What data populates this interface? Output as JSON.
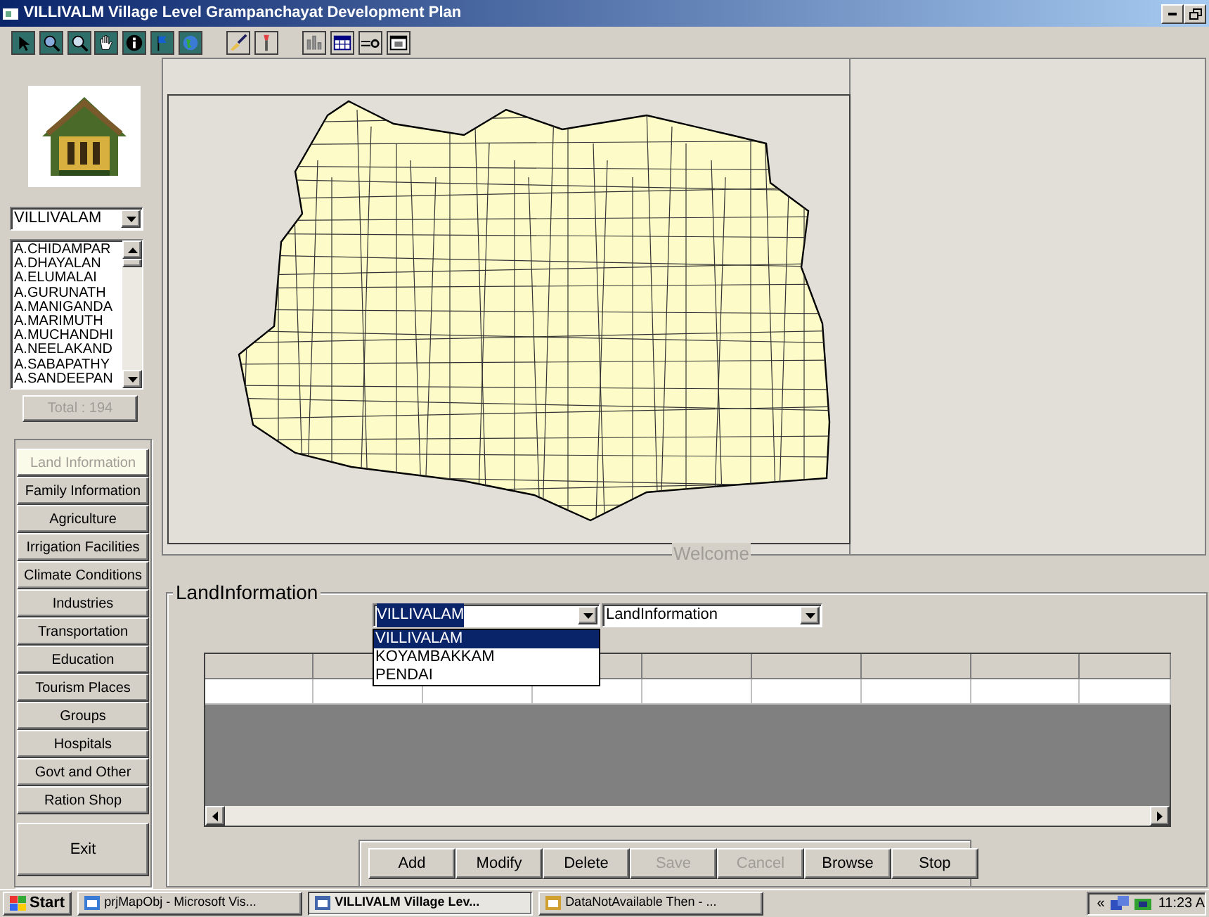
{
  "window": {
    "title": "VILLIVALM Village Level Grampanchayat Development Plan"
  },
  "village_select": {
    "value": "VILLIVALAM"
  },
  "names_list": [
    "A.CHIDAMPAR",
    "A.DHAYALAN",
    "A.ELUMALAI",
    "A.GURUNATH",
    "A.MANIGANDA",
    "A.MARIMUTH",
    "A.MUCHANDHI",
    "A.NEELAKAND",
    "A.SABAPATHY",
    "A.SANDEEPAN"
  ],
  "total": {
    "label": "Total : 194",
    "disabled": true
  },
  "menu": [
    {
      "label": "Land Information",
      "selected": true
    },
    {
      "label": "Family Information",
      "selected": false
    },
    {
      "label": "Agriculture",
      "selected": false
    },
    {
      "label": "Irrigation Facilities",
      "selected": false
    },
    {
      "label": "Climate Conditions",
      "selected": false
    },
    {
      "label": "Industries",
      "selected": false
    },
    {
      "label": "Transportation",
      "selected": false
    },
    {
      "label": "Education",
      "selected": false
    },
    {
      "label": "Tourism Places",
      "selected": false
    },
    {
      "label": "Groups",
      "selected": false
    },
    {
      "label": "Hospitals",
      "selected": false
    },
    {
      "label": "Govt and Other",
      "selected": false
    },
    {
      "label": "Ration Shop",
      "selected": false
    }
  ],
  "exit_button": "Exit",
  "map_caption": "Welcome",
  "land_information": {
    "title": "LandInformation",
    "village_combo": {
      "value": "VILLIVALAM",
      "options": [
        {
          "label": "VILLIVALAM",
          "selected": true
        },
        {
          "label": "KOYAMBAKKAM",
          "selected": false
        },
        {
          "label": "PENDAI",
          "selected": false
        }
      ]
    },
    "category_combo": {
      "value": "LandInformation"
    }
  },
  "actions": [
    {
      "label": "Add",
      "disabled": false
    },
    {
      "label": "Modify",
      "disabled": false
    },
    {
      "label": "Delete",
      "disabled": false
    },
    {
      "label": "Save",
      "disabled": true
    },
    {
      "label": "Cancel",
      "disabled": true
    },
    {
      "label": "Browse",
      "disabled": false
    },
    {
      "label": "Stop",
      "disabled": false
    }
  ],
  "taskbar": {
    "start": "Start",
    "items": [
      {
        "label": "prjMapObj - Microsoft Vis...",
        "selected": false
      },
      {
        "label": "VILLIVALM Village Lev...",
        "selected": true
      },
      {
        "label": "DataNotAvailable Then - ...",
        "selected": false
      }
    ],
    "tray_arrow": "«",
    "clock": "11:23 A"
  }
}
